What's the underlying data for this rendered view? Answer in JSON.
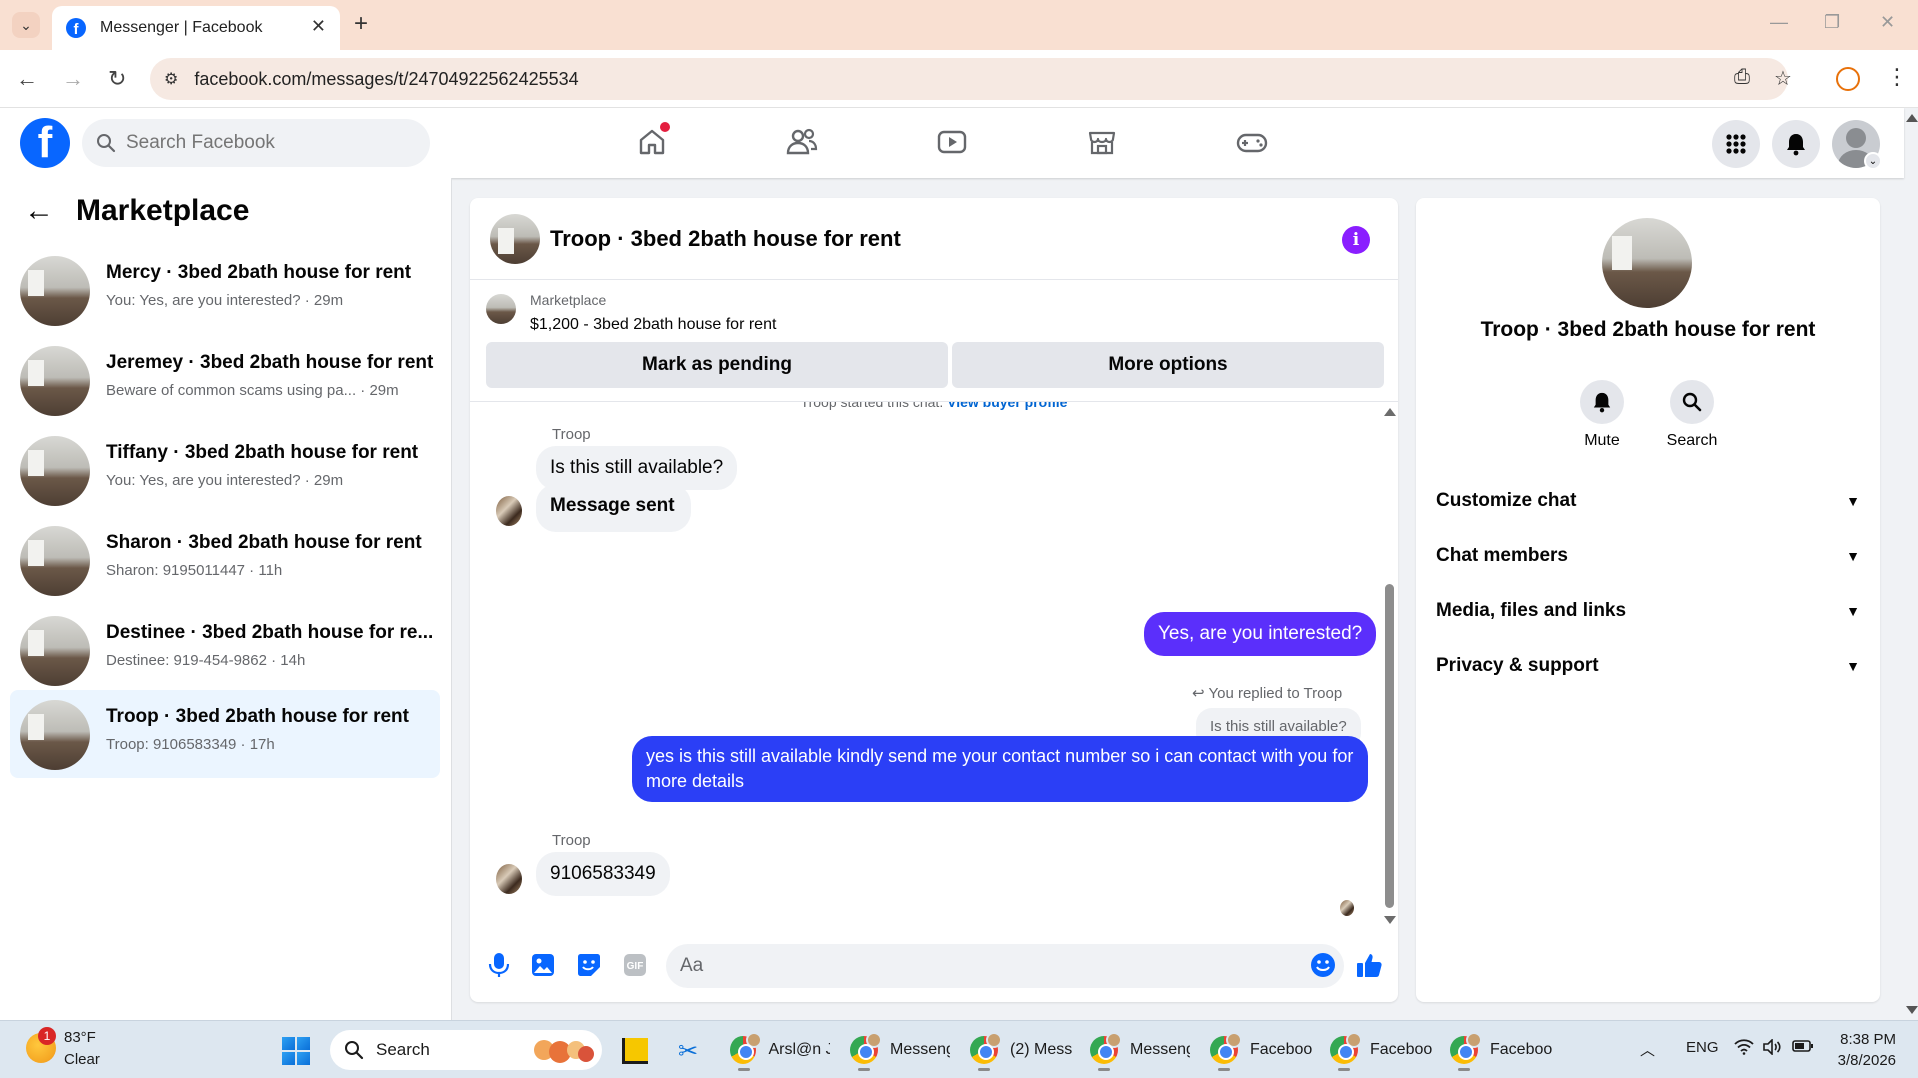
{
  "browser": {
    "tab_title": "Messenger | Facebook",
    "url": "facebook.com/messages/t/24704922562425534"
  },
  "header": {
    "search_placeholder": "Search Facebook",
    "brand_color": "#0866ff"
  },
  "sidebar": {
    "title": "Marketplace",
    "conversations": [
      {
        "name": "Mercy · 3bed 2bath house for rent",
        "snippet": "You: Yes, are you interested? · 29m"
      },
      {
        "name": "Jeremey · 3bed 2bath house for rent",
        "snippet": "Beware of common scams using pa... · 29m"
      },
      {
        "name": "Tiffany · 3bed 2bath house for rent",
        "snippet": "You: Yes, are you interested? · 29m"
      },
      {
        "name": "Sharon · 3bed 2bath house for rent",
        "snippet": "Sharon: 9195011447 · 11h"
      },
      {
        "name": "Destinee · 3bed 2bath house for re...",
        "snippet": "Destinee: 919-454-9862 · 14h"
      },
      {
        "name": "Troop · 3bed 2bath house for rent",
        "snippet": "Troop: 9106583349 · 17h"
      }
    ]
  },
  "chat": {
    "title": "Troop · 3bed 2bath house for rent",
    "listing": {
      "label": "Marketplace",
      "price_title": "$1,200 - 3bed 2bath house for rent",
      "mark_pending": "Mark as pending",
      "more_options": "More options"
    },
    "started_text": "Troop started this chat.",
    "view_buyer": "View buyer profile",
    "messages": {
      "sender_1": "Troop",
      "msg_1": "Is this still available?",
      "msg_2": "Message sent",
      "out_1": "Yes, are you interested?",
      "reply_note": "You replied to Troop",
      "reply_quote": "Is this still available?",
      "out_2": "yes is this still available kindly send me your contact number so i can contact with you for more details",
      "sender_2": "Troop",
      "msg_3": "9106583349"
    },
    "composer_placeholder": "Aa",
    "accent_color": "#5b2ffb"
  },
  "info_panel": {
    "title": "Troop · 3bed 2bath house for rent",
    "mute": "Mute",
    "search": "Search",
    "sections": [
      "Customize chat",
      "Chat members",
      "Media, files and links",
      "Privacy & support"
    ]
  },
  "taskbar": {
    "temp": "83°F",
    "condition": "Clear",
    "weather_badge": "1",
    "search": "Search",
    "apps": [
      "Arsl@n J",
      "Messeng",
      "(2) Mess",
      "Messeng",
      "Faceboo",
      "Faceboo",
      "Faceboo"
    ],
    "lang": "ENG",
    "time": "8:38 PM",
    "date": "3/8/2026"
  }
}
